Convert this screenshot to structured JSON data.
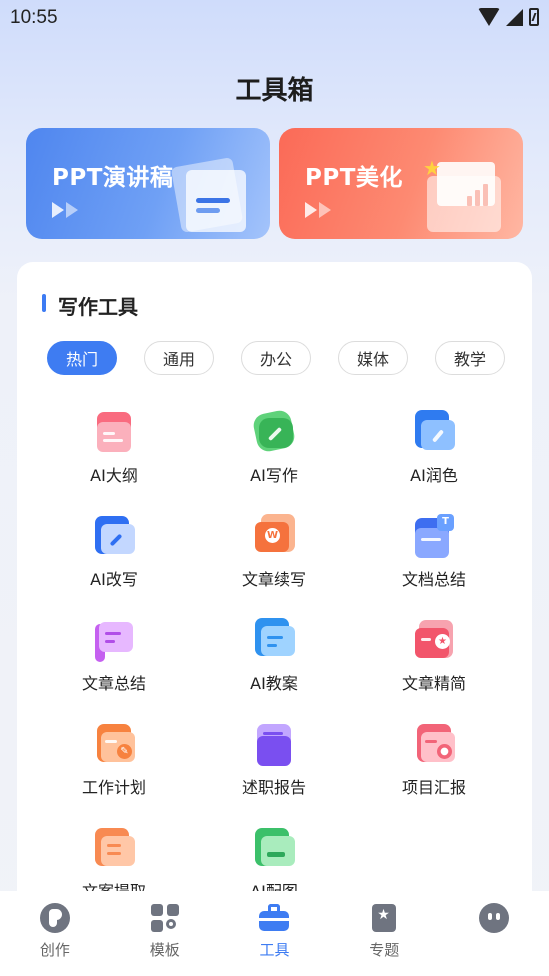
{
  "status_bar": {
    "time": "10:55"
  },
  "page": {
    "title": "工具箱"
  },
  "banners": [
    {
      "title": "PPT演讲稿",
      "icon": "document-stack-icon"
    },
    {
      "title": "PPT美化",
      "icon": "chart-folder-icon"
    }
  ],
  "section": {
    "title": "写作工具"
  },
  "tabs": [
    {
      "label": "热门",
      "active": true
    },
    {
      "label": "通用",
      "active": false
    },
    {
      "label": "办公",
      "active": false
    },
    {
      "label": "媒体",
      "active": false
    },
    {
      "label": "教学",
      "active": false
    }
  ],
  "tools": [
    {
      "label": "AI大纲",
      "icon": "outline-icon",
      "color": "#f7677c"
    },
    {
      "label": "AI写作",
      "icon": "pen-icon",
      "color": "#3fbf5d"
    },
    {
      "label": "AI润色",
      "icon": "feather-icon",
      "color": "#3a88f5"
    },
    {
      "label": "AI改写",
      "icon": "rewrite-folder-icon",
      "color": "#3a7ef5"
    },
    {
      "label": "文章续写",
      "icon": "word-doc-icon",
      "color": "#f57a45"
    },
    {
      "label": "文档总结",
      "icon": "text-doc-icon",
      "color": "#4d72ee"
    },
    {
      "label": "文章总结",
      "icon": "summary-icon",
      "color": "#b561ef"
    },
    {
      "label": "AI教案",
      "icon": "lesson-plan-icon",
      "color": "#3a9ef2"
    },
    {
      "label": "文章精简",
      "icon": "star-doc-icon",
      "color": "#f5687a"
    },
    {
      "label": "工作计划",
      "icon": "plan-icon",
      "color": "#f6844c"
    },
    {
      "label": "述职报告",
      "icon": "report-icon",
      "color": "#8a5cf0"
    },
    {
      "label": "项目汇报",
      "icon": "project-icon",
      "color": "#f56c7c"
    },
    {
      "label": "文案提取",
      "icon": "extract-icon",
      "color": "#f5814b"
    },
    {
      "label": "AI配图",
      "icon": "image-icon",
      "color": "#3fbf6a"
    }
  ],
  "nav": [
    {
      "label": "创作",
      "icon": "create-icon",
      "active": false
    },
    {
      "label": "模板",
      "icon": "template-icon",
      "active": false
    },
    {
      "label": "工具",
      "icon": "toolbox-icon",
      "active": true
    },
    {
      "label": "专题",
      "icon": "topic-icon",
      "active": false
    },
    {
      "label": "",
      "icon": "chat-bot-icon",
      "active": false
    }
  ],
  "colors": {
    "accent": "#3e7cf2",
    "ppt_banner": "#5a8ff2",
    "beauty_banner": "#fc7a63"
  }
}
